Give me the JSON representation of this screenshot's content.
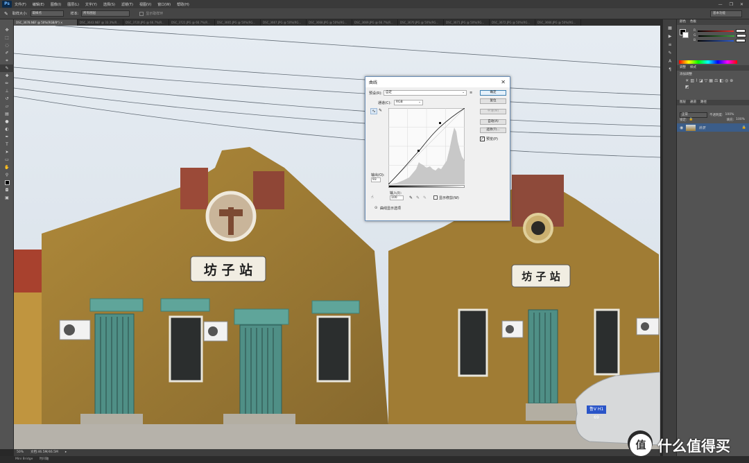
{
  "app": {
    "logo": "Ps"
  },
  "menubar": {
    "items": [
      "文件(F)",
      "编辑(E)",
      "图像(I)",
      "图层(L)",
      "文字(Y)",
      "选择(S)",
      "滤镜(T)",
      "视图(V)",
      "窗口(W)",
      "帮助(H)"
    ],
    "controls": [
      "—",
      "❐",
      "✕"
    ]
  },
  "options": {
    "sample_size_label": "取样大小:",
    "sample_size_value": "取样点",
    "sample_label": "样本:",
    "sample_value": "所有图层",
    "show_ring_label": "显示取样环",
    "workspace": "基本功能"
  },
  "tabs": [
    "DSC_3678.NEF @ 50%(RGB/8*) ×",
    "DSC_3643.NEF @ 33.3%(R...",
    "DSC_3720.JPG @ 66.7%(R...",
    "DSC_3721.JPG @ 66.7%(R...",
    "DSC_3665.JPG @ 50%(RG...",
    "DSC_3667.JPG @ 50%(RG...",
    "DSC_3668.JPG @ 50%(RG...",
    "DSC_3669.JPG @ 66.7%(R...",
    "DSC_3670.JPG @ 50%(RG...",
    "DSC_3671.JPG @ 50%(RG...",
    "DSC_3672.JPG @ 50%(RG...",
    "DSC_3666.JPG @ 50%(RG..."
  ],
  "photo": {
    "sign_left": "坊 子 站",
    "sign_right": "坊 子 站",
    "plate": "鲁V H1 69"
  },
  "status": {
    "zoom": "50%",
    "doc": "文档:46.5M/46.5M"
  },
  "bridge": {
    "label": "Mini Bridge",
    "label2": "时间轴"
  },
  "panels": {
    "color_tabs": [
      "颜色",
      "色板"
    ],
    "color_rows": [
      {
        "label": "R",
        "color": "#e0302a"
      },
      {
        "label": "G",
        "color": "#3aa53a"
      },
      {
        "label": "B",
        "color": "#2a5cd8"
      }
    ],
    "adjust_tabs": [
      "调整",
      "样式"
    ],
    "adjust_title": "添加调整",
    "layers_tabs": [
      "图层",
      "通道",
      "路径"
    ],
    "blend_mode": "正常",
    "opacity_label": "不透明度:",
    "opacity_value": "100%",
    "lock_label": "锁定:",
    "fill_label": "填充:",
    "fill_value": "100%",
    "layer_name": "背景"
  },
  "watermark": {
    "text": "什么值得买",
    "badge": "值"
  },
  "curves": {
    "title": "曲线",
    "preset_label": "预设(R):",
    "preset_value": "自定",
    "channel_label": "通道(C):",
    "channel_value": "RGB",
    "output_label": "输出(O):",
    "output_value": "93",
    "input_label": "输入(I):",
    "input_value": "100",
    "show_clipping": "显示修剪(W)",
    "display_options": "曲线显示选项",
    "buttons": {
      "ok": "确定",
      "reset": "复位",
      "smooth": "平滑(M)",
      "auto": "自动(A)",
      "options": "选项(T)...",
      "preview": "预览(P)"
    }
  }
}
